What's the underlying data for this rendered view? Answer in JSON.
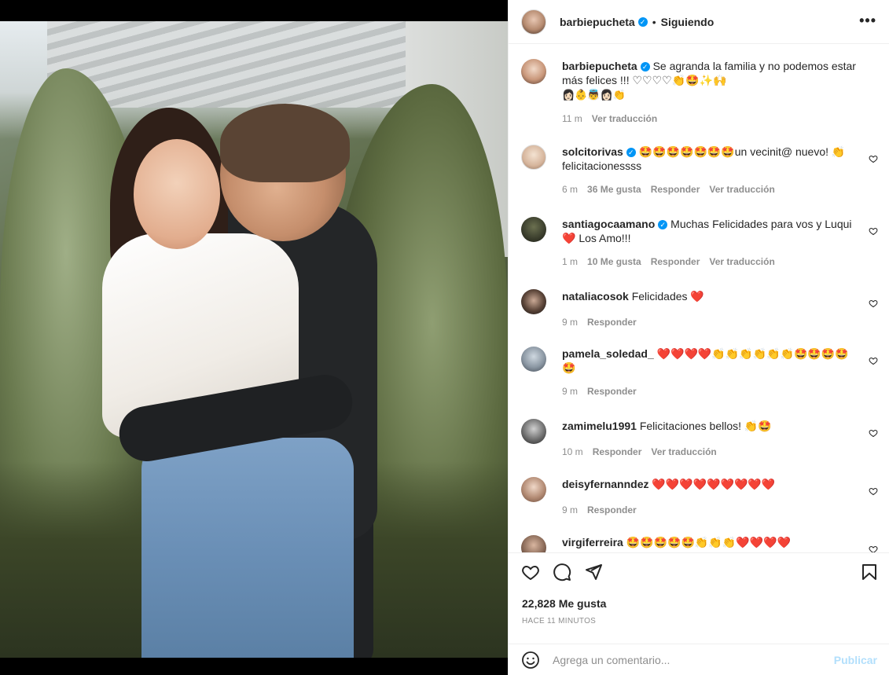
{
  "post": {
    "author": "barbiepucheta",
    "follow_state": "Siguiendo",
    "separator": "•",
    "more_label": "•••",
    "verified_glyph": "✓"
  },
  "caption": {
    "username": "barbiepucheta",
    "text_line1": "Se agranda la familia y no podemos estar",
    "text_line2": "más felices !!! ♡♡♡♡👏🤩✨🙌",
    "emoji_line": "👩🏻👶👼👩🏻👏",
    "time": "11 m",
    "translate": "Ver traducción"
  },
  "comments": [
    {
      "username": "solcitorivas",
      "verified": true,
      "text": "🤩🤩🤩🤩🤩🤩🤩un vecinit@ nuevo! 👏 felicitacionessss",
      "time": "6 m",
      "likes": "36 Me gusta",
      "reply": "Responder",
      "translate": "Ver traducción"
    },
    {
      "username": "santiagocaamano",
      "verified": true,
      "text": "Muchas Felicidades para vos y Luqui❤️ Los Amo!!!",
      "time": "1 m",
      "likes": "10 Me gusta",
      "reply": "Responder",
      "translate": "Ver traducción"
    },
    {
      "username": "nataliacosok",
      "verified": false,
      "text": "Felicidades ❤️",
      "time": "9 m",
      "reply": "Responder"
    },
    {
      "username": "pamela_soledad_",
      "verified": false,
      "text": "❤️❤️❤️❤️👏👏👏👏👏👏🤩🤩🤩🤩🤩",
      "time": "9 m",
      "reply": "Responder"
    },
    {
      "username": "zamimelu1991",
      "verified": false,
      "text": "Felicitaciones bellos! 👏🤩",
      "time": "10 m",
      "reply": "Responder",
      "translate": "Ver traducción"
    },
    {
      "username": "deisyfernanndez",
      "verified": false,
      "text": "❤️❤️❤️❤️❤️❤️❤️❤️❤️",
      "time": "9 m",
      "reply": "Responder"
    },
    {
      "username": "virgiferreira",
      "verified": false,
      "text": "🤩🤩🤩🤩🤩👏👏👏❤️❤️❤️❤️"
    }
  ],
  "stats": {
    "likes": "22,828 Me gusta",
    "time": "HACE 11 MINUTOS"
  },
  "composer": {
    "placeholder": "Agrega un comentario...",
    "publish": "Publicar"
  },
  "icons": {
    "like": "heart-icon",
    "comment": "comment-icon",
    "share": "share-icon",
    "save": "bookmark-icon",
    "emoji": "smiley-icon"
  },
  "colors": {
    "verified": "#0095f6",
    "publish_disabled": "#b2dffc",
    "meta_text": "#8e8e8e"
  }
}
